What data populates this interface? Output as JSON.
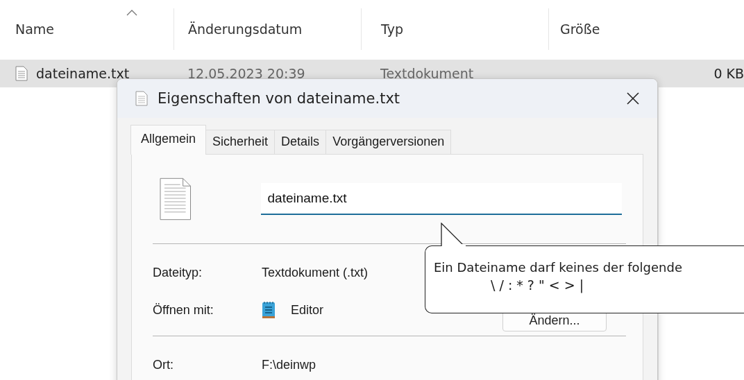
{
  "explorer": {
    "columns": [
      "Name",
      "Änderungsdatum",
      "Typ",
      "Größe"
    ],
    "files": [
      {
        "name": "dateiname.txt",
        "modified": "12.05.2023 20:39",
        "type": "Textdokument",
        "size": "0 KB",
        "selected": true
      }
    ]
  },
  "dialog": {
    "title": "Eigenschaften von dateiname.txt",
    "tabs": [
      {
        "label": "Allgemein",
        "selected": true
      },
      {
        "label": "Sicherheit",
        "selected": false
      },
      {
        "label": "Details",
        "selected": false
      },
      {
        "label": "Vorgängerversionen",
        "selected": false
      }
    ],
    "name_field": {
      "value": "dateiname.txt"
    },
    "property_groups": [
      [
        {
          "kind": "text",
          "label": "Dateityp:",
          "value": "Textdokument (.txt)"
        },
        {
          "kind": "app",
          "label": "Öffnen mit:",
          "value": "Editor",
          "button": "Ändern..."
        }
      ],
      [
        {
          "kind": "text",
          "label": "Ort:",
          "value": "F:\\deinwp"
        }
      ]
    ],
    "tooltip": {
      "lines": [
        "Ein Dateiname darf keines der folgende",
        "\\ / : * ? \" < > |"
      ]
    }
  }
}
